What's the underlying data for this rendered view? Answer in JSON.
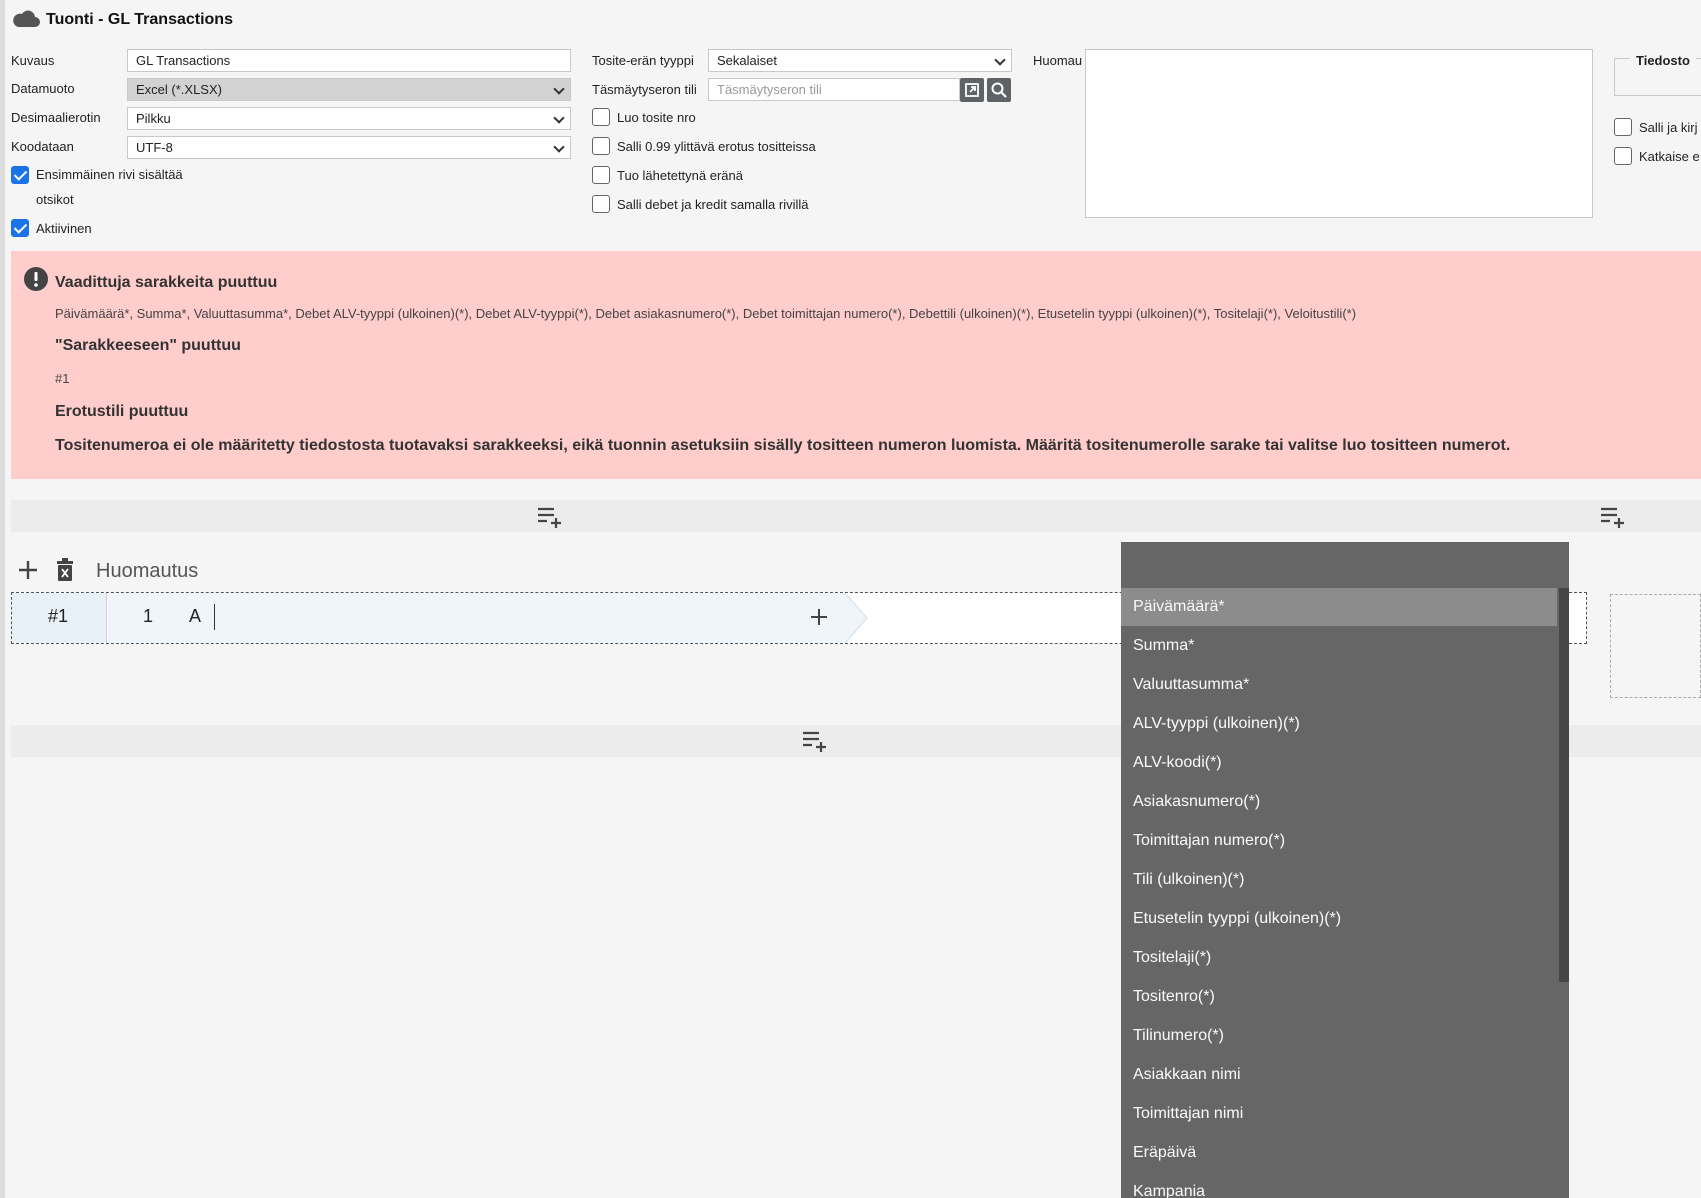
{
  "header": {
    "title": "Tuonti - GL Transactions"
  },
  "form": {
    "kuvaus_label": "Kuvaus",
    "kuvaus_value": "GL Transactions",
    "datamuoto_label": "Datamuoto",
    "datamuoto_value": "Excel (*.XLSX)",
    "desimaali_label": "Desimaalierotin",
    "desimaali_value": "Pilkku",
    "koodataan_label": "Koodataan",
    "koodataan_value": "UTF-8",
    "first_row_line1": "Ensimmäinen rivi sisältää",
    "first_row_line2": "otsikot",
    "aktiivinen_label": "Aktiivinen",
    "tosite_label": "Tosite-erän tyyppi",
    "tosite_value": "Sekalaiset",
    "tasmays_label": "Täsmäytyseron tili",
    "tasmays_placeholder": "Täsmäytyseron tili",
    "luo_label": "Luo tosite nro",
    "salli099_label": "Salli 0.99 ylittävä erotus tositteissa",
    "tuo_label": "Tuo lähetettynä eränä",
    "salli_debet_label": "Salli debet ja kredit samalla rivillä",
    "huomau_label": "Huomau",
    "tiedosto_label": "Tiedosto",
    "salli_kirj_label": "Salli ja kirj",
    "katkaise_label": "Katkaise e"
  },
  "errors": {
    "title1": "Vaadittuja sarakkeita puuttuu",
    "text1": "Päivämäärä*, Summa*, Valuuttasumma*, Debet ALV-tyyppi (ulkoinen)(*), Debet ALV-tyyppi(*), Debet asiakasnumero(*), Debet toimittajan numero(*), Debettili (ulkoinen)(*), Etusetelin tyyppi (ulkoinen)(*), Tositelaji(*), Veloitustili(*)",
    "title2": "\"Sarakkeeseen\" puuttuu",
    "text2": "#1",
    "title3": "Erotustili puuttuu",
    "title4": "Tositenumeroa ei ole määritetty tiedostosta tuotavaksi sarakkeeksi, eikä tuonnin asetuksiin sisälly tositteen numeron luomista. Määritä tositenumerolle sarake tai valitse luo tositteen numerot."
  },
  "rows": {
    "huomautus_label": "Huomautus",
    "row_id": "#1",
    "row_num": "1",
    "row_col": "A"
  },
  "dropdown": {
    "items": [
      "Päivämäärä*",
      "Summa*",
      "Valuuttasumma*",
      "ALV-tyyppi (ulkoinen)(*)",
      "ALV-koodi(*)",
      "Asiakasnumero(*)",
      "Toimittajan numero(*)",
      "Tili (ulkoinen)(*)",
      "Etusetelin tyyppi (ulkoinen)(*)",
      "Tositelaji(*)",
      "Tositenro(*)",
      "Tilinumero(*)",
      "Asiakkaan nimi",
      "Toimittajan nimi",
      "Eräpäivä",
      "Kampania"
    ],
    "selected_index": 0
  },
  "colors": {
    "accent": "#1a73e8",
    "error_bg": "#ffcdcc",
    "dropdown_bg": "#666666"
  }
}
